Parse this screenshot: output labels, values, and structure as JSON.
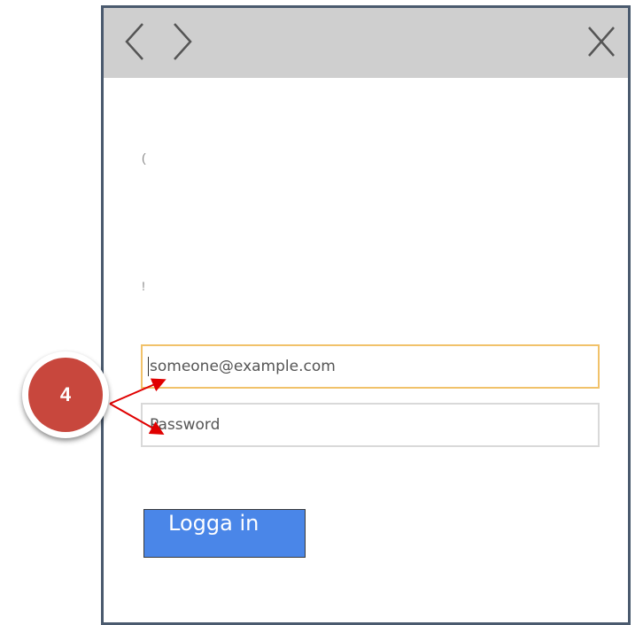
{
  "titlebar": {
    "back_icon": "chevron-left-icon",
    "forward_icon": "chevron-right-icon",
    "close_icon": "close-icon"
  },
  "clipped_chars": [
    "(",
    "!"
  ],
  "email": {
    "value": "someone@example.com"
  },
  "password": {
    "value": "Password"
  },
  "login_button": {
    "label": "Logga in"
  },
  "callout": {
    "number": "4",
    "color": "#c8473d"
  },
  "colors": {
    "titlebar": "#cfcfcf",
    "window_border": "#4a5a6e",
    "email_focus_border": "#f1c26a",
    "button": "#4a86e8",
    "arrow": "#e00000"
  }
}
